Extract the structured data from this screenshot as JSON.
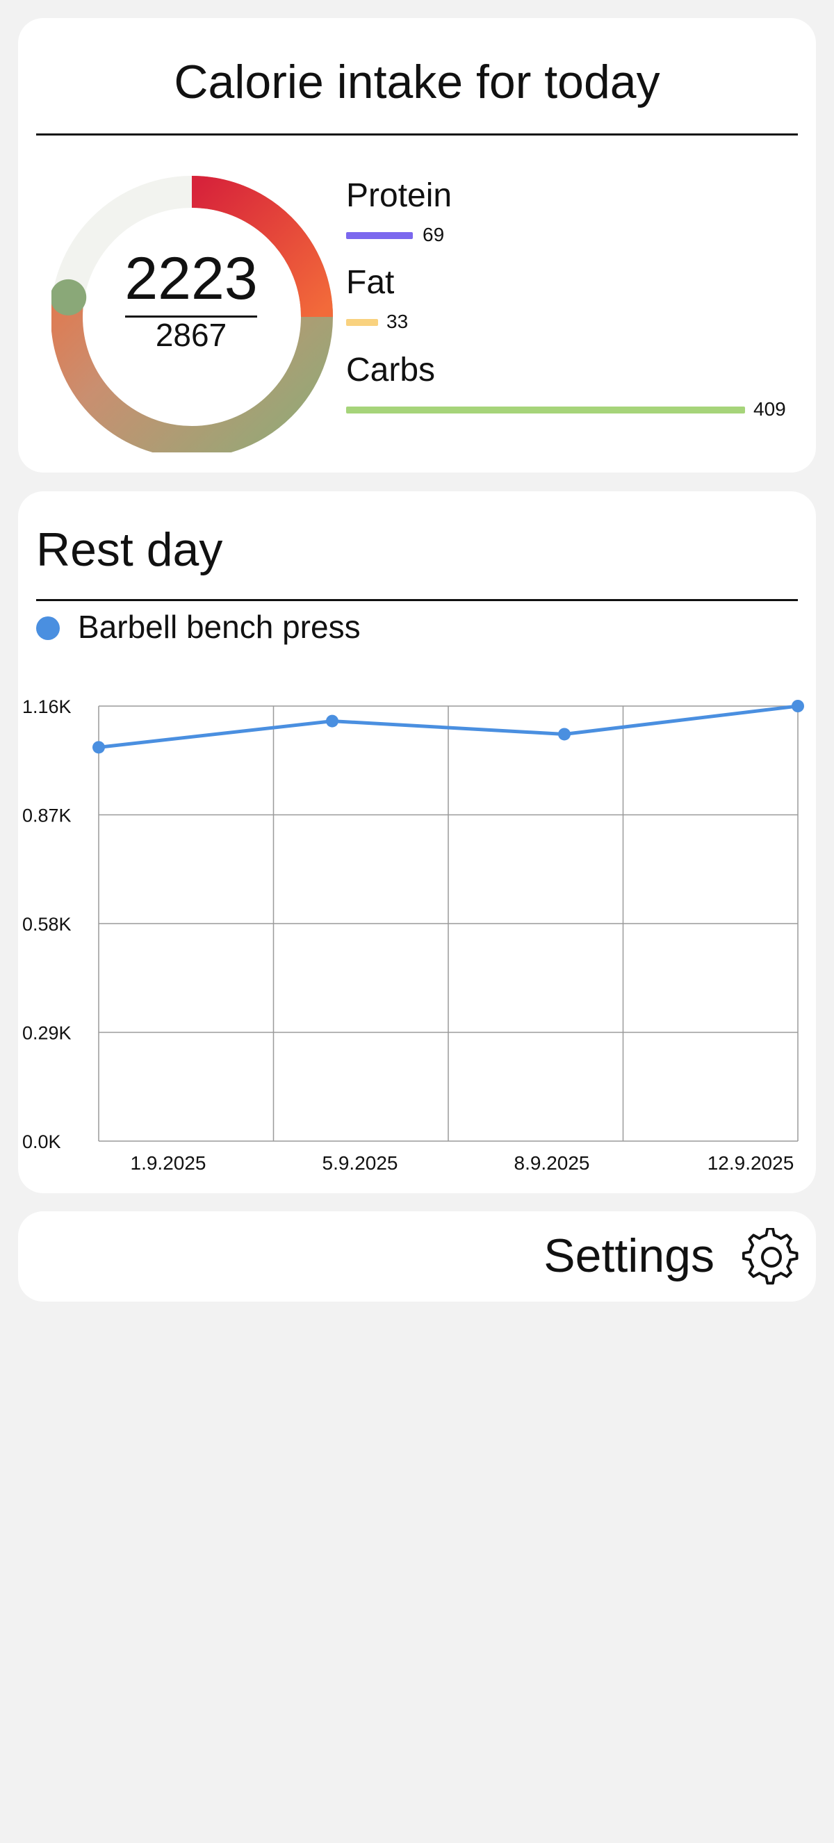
{
  "calories": {
    "title": "Calorie intake for today",
    "consumed": "2223",
    "goal": "2867",
    "progress_fraction": 0.775,
    "macros": [
      {
        "name": "Protein",
        "value": "69",
        "color": "#7b68ee"
      },
      {
        "name": "Fat",
        "value": "33",
        "color": "#f9d27f"
      },
      {
        "name": "Carbs",
        "value": "409",
        "color": "#a6d47a"
      }
    ]
  },
  "workout": {
    "title": "Rest day",
    "legend_label": "Barbell bench press",
    "accent": "#4a8fe0"
  },
  "chart_data": {
    "type": "line",
    "title": "",
    "xlabel": "",
    "ylabel": "",
    "x": [
      "1.9.2025",
      "5.9.2025",
      "8.9.2025",
      "12.9.2025"
    ],
    "x_tick_labels": [
      "1.9.2025",
      "5.9.2025",
      "8.9.2025",
      "12.9.2025"
    ],
    "y_tick_labels": [
      "1.16K",
      "0.87K",
      "0.58K",
      "0.29K",
      "0.0K"
    ],
    "ylim": [
      0,
      1160
    ],
    "grid": true,
    "series": [
      {
        "name": "Barbell bench press",
        "values": [
          1050,
          1120,
          1085,
          1160
        ],
        "color": "#4a8fe0"
      }
    ]
  },
  "settings": {
    "label": "Settings",
    "icon": "gear-icon"
  }
}
